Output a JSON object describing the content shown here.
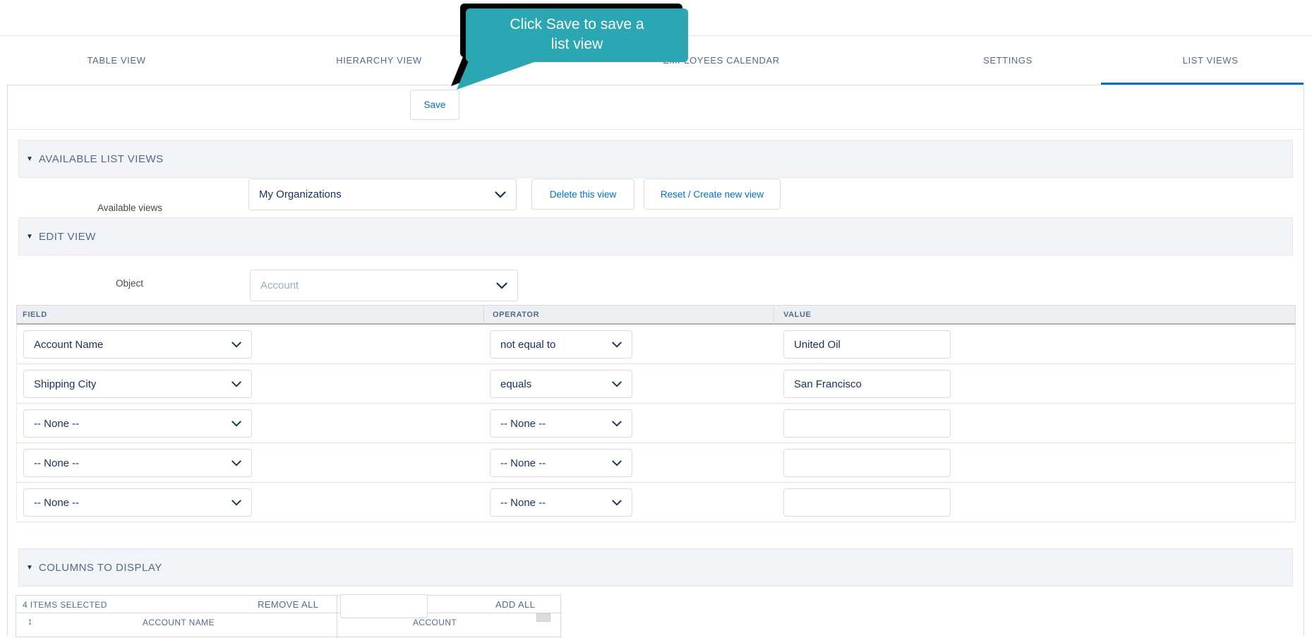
{
  "tooltip": {
    "line1": "Click Save to save a",
    "line2": "list view",
    "color": "#2aa7b3"
  },
  "tabs": {
    "items": [
      {
        "label": "TABLE VIEW",
        "active": false
      },
      {
        "label": "HIERARCHY VIEW",
        "active": false
      },
      {
        "label": "EMPLOYEES CALENDAR",
        "active": false
      },
      {
        "label": "SETTINGS",
        "active": false
      },
      {
        "label": "LIST VIEWS",
        "active": true
      }
    ]
  },
  "toolbar": {
    "save_label": "Save"
  },
  "sections": {
    "available": {
      "title": "AVAILABLE LIST VIEWS",
      "views_label": "Available views",
      "selected_view": "My Organizations",
      "delete_label": "Delete this view",
      "reset_label": "Reset / Create new view"
    },
    "edit": {
      "title": "EDIT VIEW",
      "object_label": "Object",
      "object_value": "Account",
      "filter": {
        "headers": [
          "FIELD",
          "OPERATOR",
          "VALUE"
        ],
        "rows": [
          {
            "field": "Account Name",
            "operator": "not equal to",
            "value": "United Oil"
          },
          {
            "field": "Shipping City",
            "operator": "equals",
            "value": "San Francisco"
          },
          {
            "field": "-- None --",
            "operator": "-- None --",
            "value": ""
          },
          {
            "field": "-- None --",
            "operator": "-- None --",
            "value": ""
          },
          {
            "field": "-- None --",
            "operator": "-- None --",
            "value": ""
          }
        ]
      }
    },
    "columns": {
      "title": "COLUMNS TO DISPLAY",
      "items_selected": "4 ITEMS SELECTED",
      "remove_all": "REMOVE ALL",
      "add_all": "ADD ALL",
      "search_value": "",
      "row_left": "ACCOUNT NAME",
      "row_right": "ACCOUNT"
    }
  },
  "colors": {
    "accent_blue": "#0070d2",
    "tooltip_teal": "#2aa7b3",
    "slate": "#54698d"
  }
}
